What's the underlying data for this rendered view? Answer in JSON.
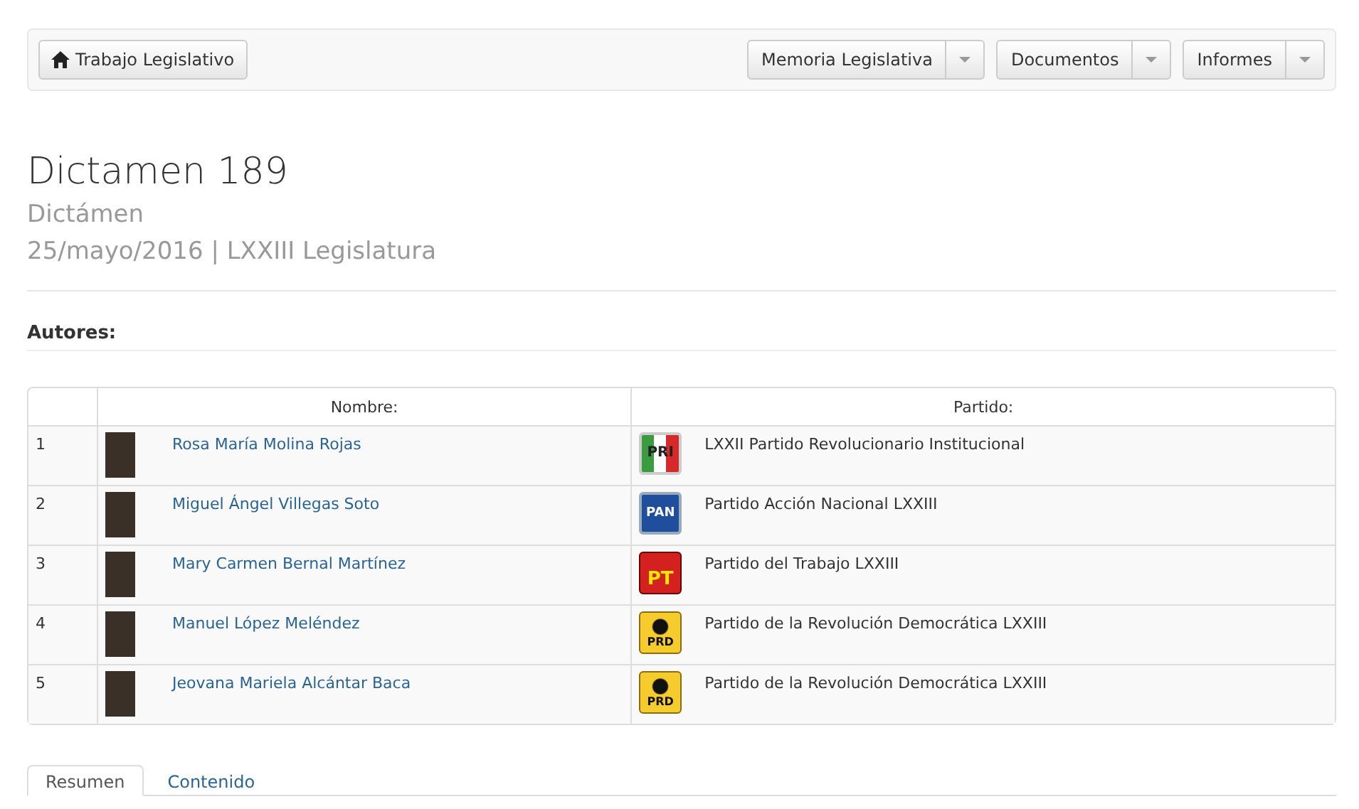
{
  "navbar": {
    "home_button": "Trabajo Legislativo",
    "dropdowns": [
      "Memoria Legislativa",
      "Documentos",
      "Informes"
    ]
  },
  "header": {
    "title": "Dictamen 189",
    "subtitle": "Dictámen",
    "meta": "25/mayo/2016 | LXXIII Legislatura"
  },
  "authors_heading": "Autores:",
  "table": {
    "columns": [
      "Nombre:",
      "Partido:"
    ],
    "rows": [
      {
        "number": "1",
        "name": "Rosa María Molina Rojas",
        "logo": {
          "kind": "pri",
          "text": "PRI"
        },
        "party": "LXXII Partido Revolucionario Institucional"
      },
      {
        "number": "2",
        "name": "Miguel Ángel Villegas Soto",
        "logo": {
          "kind": "pan",
          "text": "PAN"
        },
        "party": "Partido Acción Nacional LXXIII"
      },
      {
        "number": "3",
        "name": "Mary Carmen Bernal Martínez",
        "logo": {
          "kind": "pt",
          "text": "PT"
        },
        "party": "Partido del Trabajo LXXIII"
      },
      {
        "number": "4",
        "name": "Manuel López Meléndez",
        "logo": {
          "kind": "prd",
          "text": "PRD"
        },
        "party": "Partido de la Revolución Democrática LXXIII"
      },
      {
        "number": "5",
        "name": "Jeovana Mariela Alcántar Baca",
        "logo": {
          "kind": "prd",
          "text": "PRD"
        },
        "party": "Partido de la Revolución Democrática LXXIII"
      }
    ]
  },
  "tabs": [
    {
      "label": "Resumen",
      "selected": true
    },
    {
      "label": "Contenido",
      "selected": false
    }
  ]
}
